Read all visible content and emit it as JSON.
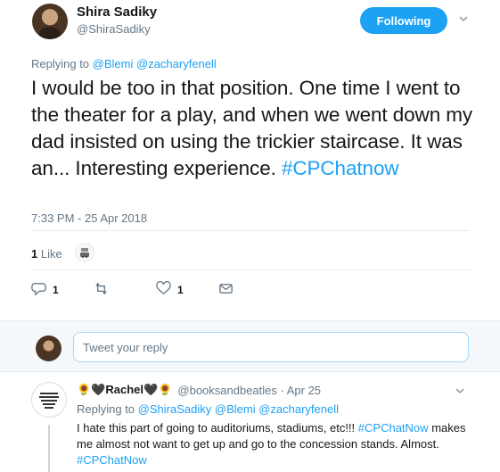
{
  "author": {
    "display_name": "Shira Sadiky",
    "handle": "@ShiraSadiky"
  },
  "follow_button_label": "Following",
  "replying": {
    "prefix": "Replying to",
    "mentions": [
      "@Blemi",
      "@zacharyfenell"
    ]
  },
  "tweet": {
    "text": "I would be too in that position.  One time I went to the theater for a play, and when we went down my dad insisted on using the trickier staircase. It was an... Interesting experience.",
    "hashtag": "#CPChatnow",
    "timestamp": "7:33 PM - 25 Apr 2018"
  },
  "stats": {
    "like_count": "1",
    "like_label": "Like"
  },
  "actions": {
    "reply_count": "1",
    "like_count": "1"
  },
  "reply_box": {
    "placeholder": "Tweet your reply"
  },
  "reply_tweet": {
    "display_name": "🌻🖤Rachel🖤🌻",
    "handle_time": "@booksandbeatles · Apr 25",
    "replying_prefix": "Replying to",
    "mentions": [
      "@ShiraSadiky",
      "@Blemi",
      "@zacharyfenell"
    ],
    "text_before": "I hate this part of going to auditoriums, stadiums, etc!!!",
    "hashtag1": "#CPChatNow",
    "text_after": "makes me almost not want to get up and go to the concession stands. Almost.",
    "hashtag2": "#CPChatNow"
  },
  "colors": {
    "accent": "#1da1f2",
    "muted": "#657786",
    "text": "#14171a"
  }
}
